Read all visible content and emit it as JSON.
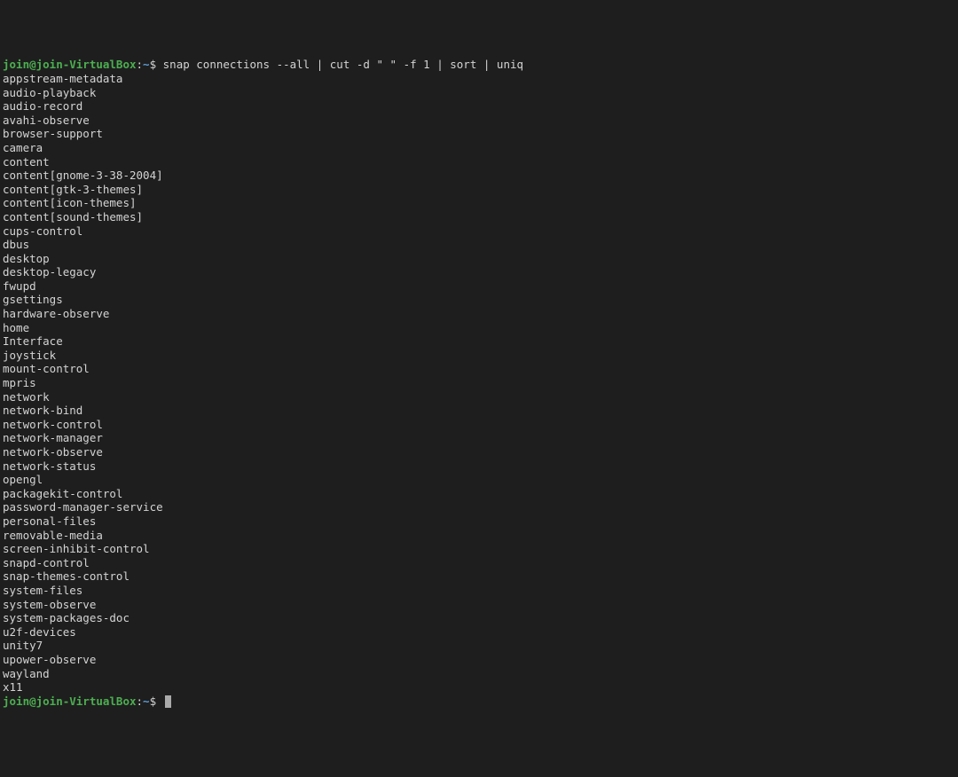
{
  "prompt1": {
    "user": "join@join-VirtualBox",
    "colon": ":",
    "path": "~",
    "dollar": "$",
    "command": "snap connections --all | cut -d \" \" -f 1 | sort | uniq"
  },
  "output": [
    "appstream-metadata",
    "audio-playback",
    "audio-record",
    "avahi-observe",
    "browser-support",
    "camera",
    "content",
    "content[gnome-3-38-2004]",
    "content[gtk-3-themes]",
    "content[icon-themes]",
    "content[sound-themes]",
    "cups-control",
    "dbus",
    "desktop",
    "desktop-legacy",
    "fwupd",
    "gsettings",
    "hardware-observe",
    "home",
    "Interface",
    "joystick",
    "mount-control",
    "mpris",
    "network",
    "network-bind",
    "network-control",
    "network-manager",
    "network-observe",
    "network-status",
    "opengl",
    "packagekit-control",
    "password-manager-service",
    "personal-files",
    "removable-media",
    "screen-inhibit-control",
    "snapd-control",
    "snap-themes-control",
    "system-files",
    "system-observe",
    "system-packages-doc",
    "u2f-devices",
    "unity7",
    "upower-observe",
    "wayland",
    "x11"
  ],
  "prompt2": {
    "user": "join@join-VirtualBox",
    "colon": ":",
    "path": "~",
    "dollar": "$"
  }
}
